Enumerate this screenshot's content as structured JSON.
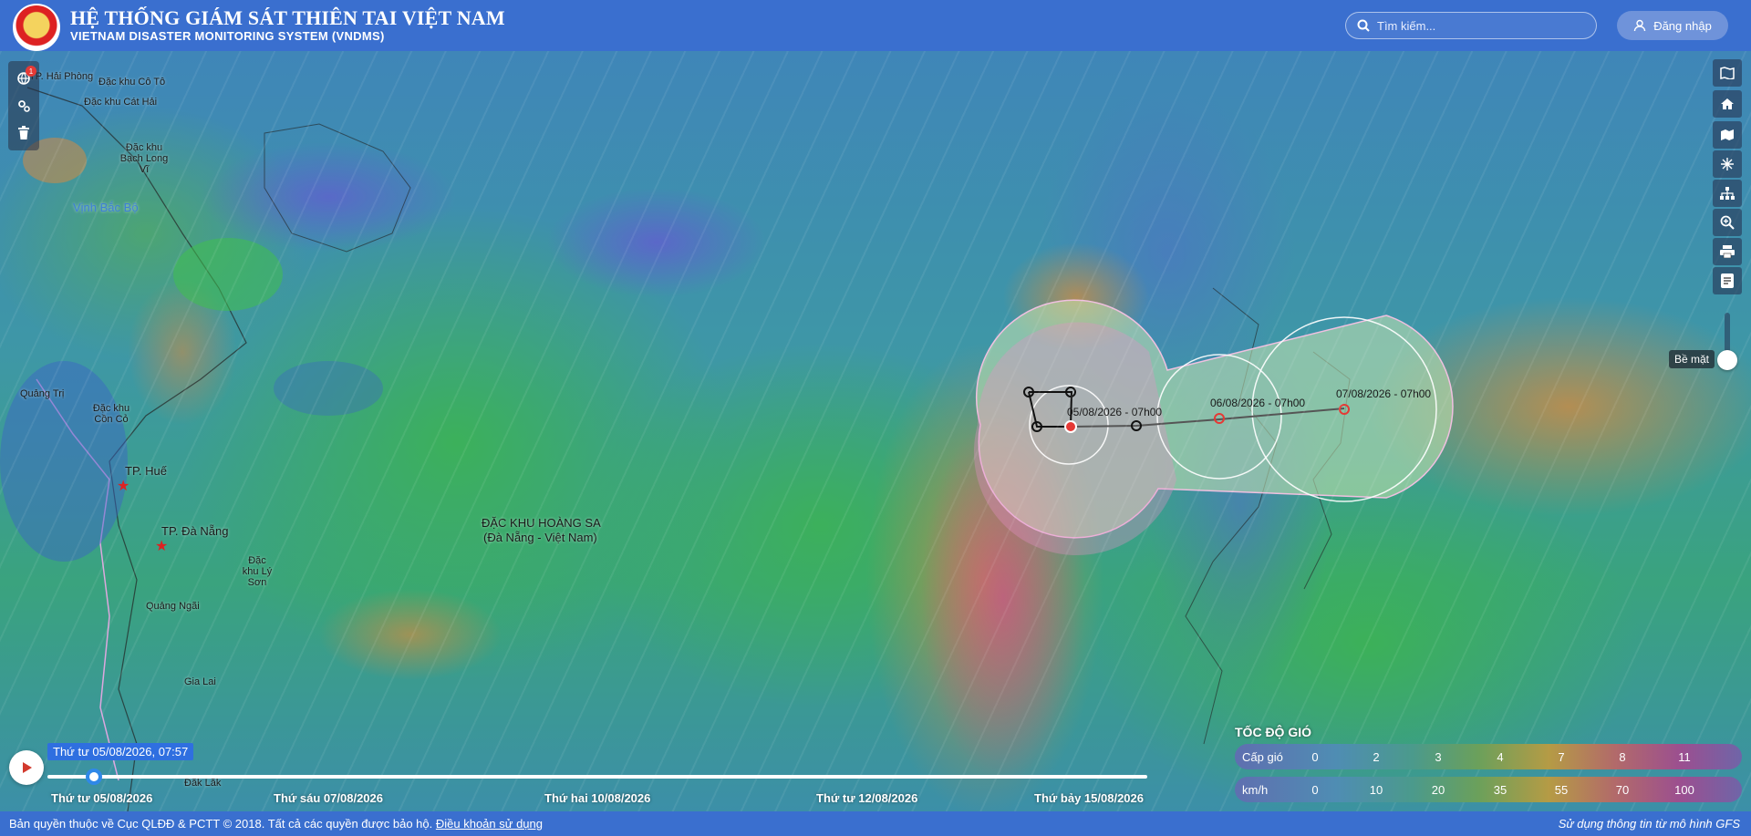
{
  "header": {
    "title": "HỆ THỐNG GIÁM SÁT THIÊN TAI VIỆT NAM",
    "subtitle": "VIETNAM DISASTER MONITORING SYSTEM (VNDMS)",
    "search_placeholder": "Tìm kiếm...",
    "login_label": "Đăng nhập"
  },
  "map": {
    "places": [
      {
        "name": "TP. Hải Phòng"
      },
      {
        "name": "Đặc khu Cô Tô"
      },
      {
        "name": "Đặc khu Cát Hải"
      },
      {
        "name": "Đặc khu Bạch Long Vĩ"
      },
      {
        "name": "Vịnh Bắc Bộ"
      },
      {
        "name": "Quảng Trị"
      },
      {
        "name": "Đặc khu Cồn Cỏ"
      },
      {
        "name": "TP. Huế"
      },
      {
        "name": "TP. Đà Nẵng"
      },
      {
        "name": "Đặc khu Lý Sơn"
      },
      {
        "name": "Quảng Ngãi"
      },
      {
        "name": "Gia Lai"
      },
      {
        "name": "Đắk Lắk"
      },
      {
        "name": "ĐẶC KHU HOÀNG SA"
      },
      {
        "name": "(Đà Nẵng - Việt Nam)"
      }
    ],
    "storm_labels": [
      "05/08/2026 - 07h00",
      "06/08/2026 - 07h00",
      "07/08/2026 - 07h00"
    ],
    "tools_badge": "1",
    "layer_label": "Bề mặt"
  },
  "timeline": {
    "current": "Thứ tư 05/08/2026, 07:57",
    "ticks": [
      "Thứ tư 05/08/2026",
      "Thứ sáu 07/08/2026",
      "Thứ hai 10/08/2026",
      "Thứ tư 12/08/2026",
      "Thứ bảy 15/08/2026"
    ]
  },
  "legend": {
    "title": "TỐC ĐỘ GIÓ",
    "level_label": "Cấp gió",
    "levels": [
      "0",
      "2",
      "3",
      "4",
      "7",
      "8",
      "11"
    ],
    "speed_label": "km/h",
    "speeds": [
      "0",
      "10",
      "20",
      "35",
      "55",
      "70",
      "100"
    ]
  },
  "footer": {
    "copyright": "Bản quyền thuộc về Cục QLĐĐ & PCTT © 2018. Tất cả các quyền được bảo hộ.",
    "terms_link": "Điều khoản sử dụng",
    "model_note": "Sử dụng thông tin từ mô hình GFS"
  },
  "colors": {
    "header_bg": "#3a6fcf",
    "accent": "#2f6fe0",
    "storm_cone": "#c8e6b0",
    "storm_pink": "#e88fc9"
  }
}
